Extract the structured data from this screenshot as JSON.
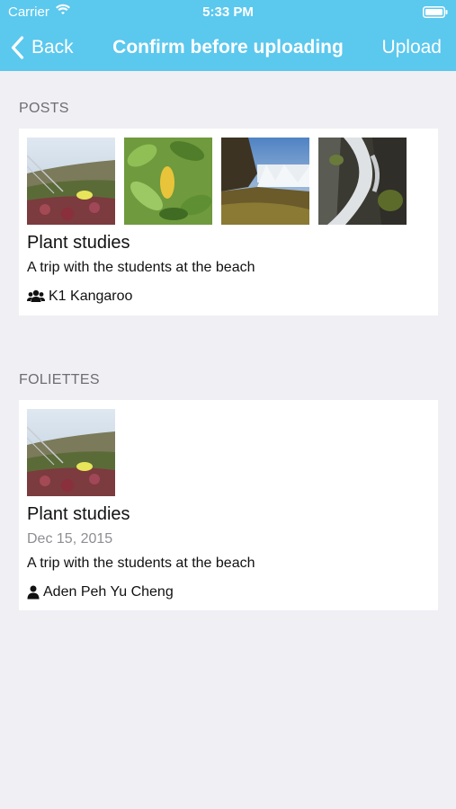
{
  "status_bar": {
    "carrier": "Carrier",
    "time": "5:33 PM"
  },
  "nav": {
    "back_label": "Back",
    "title": "Confirm before uploading",
    "upload_label": "Upload"
  },
  "posts": {
    "section_label": "POSTS",
    "card": {
      "images": [
        "beach-plants-photo",
        "green-leaves-photo",
        "waterfall-cliff-photo",
        "waterfall-rocks-photo"
      ],
      "title": "Plant studies",
      "description": "A trip with the students at the beach",
      "group_icon": "group-icon",
      "group": "K1 Kangaroo"
    }
  },
  "foliettes": {
    "section_label": "FOLIETTES",
    "card": {
      "images": [
        "beach-plants-photo"
      ],
      "title": "Plant studies",
      "date": "Dec 15, 2015",
      "description": "A trip with the students at the beach",
      "person_icon": "person-icon",
      "author": "Aden Peh Yu Cheng"
    }
  }
}
